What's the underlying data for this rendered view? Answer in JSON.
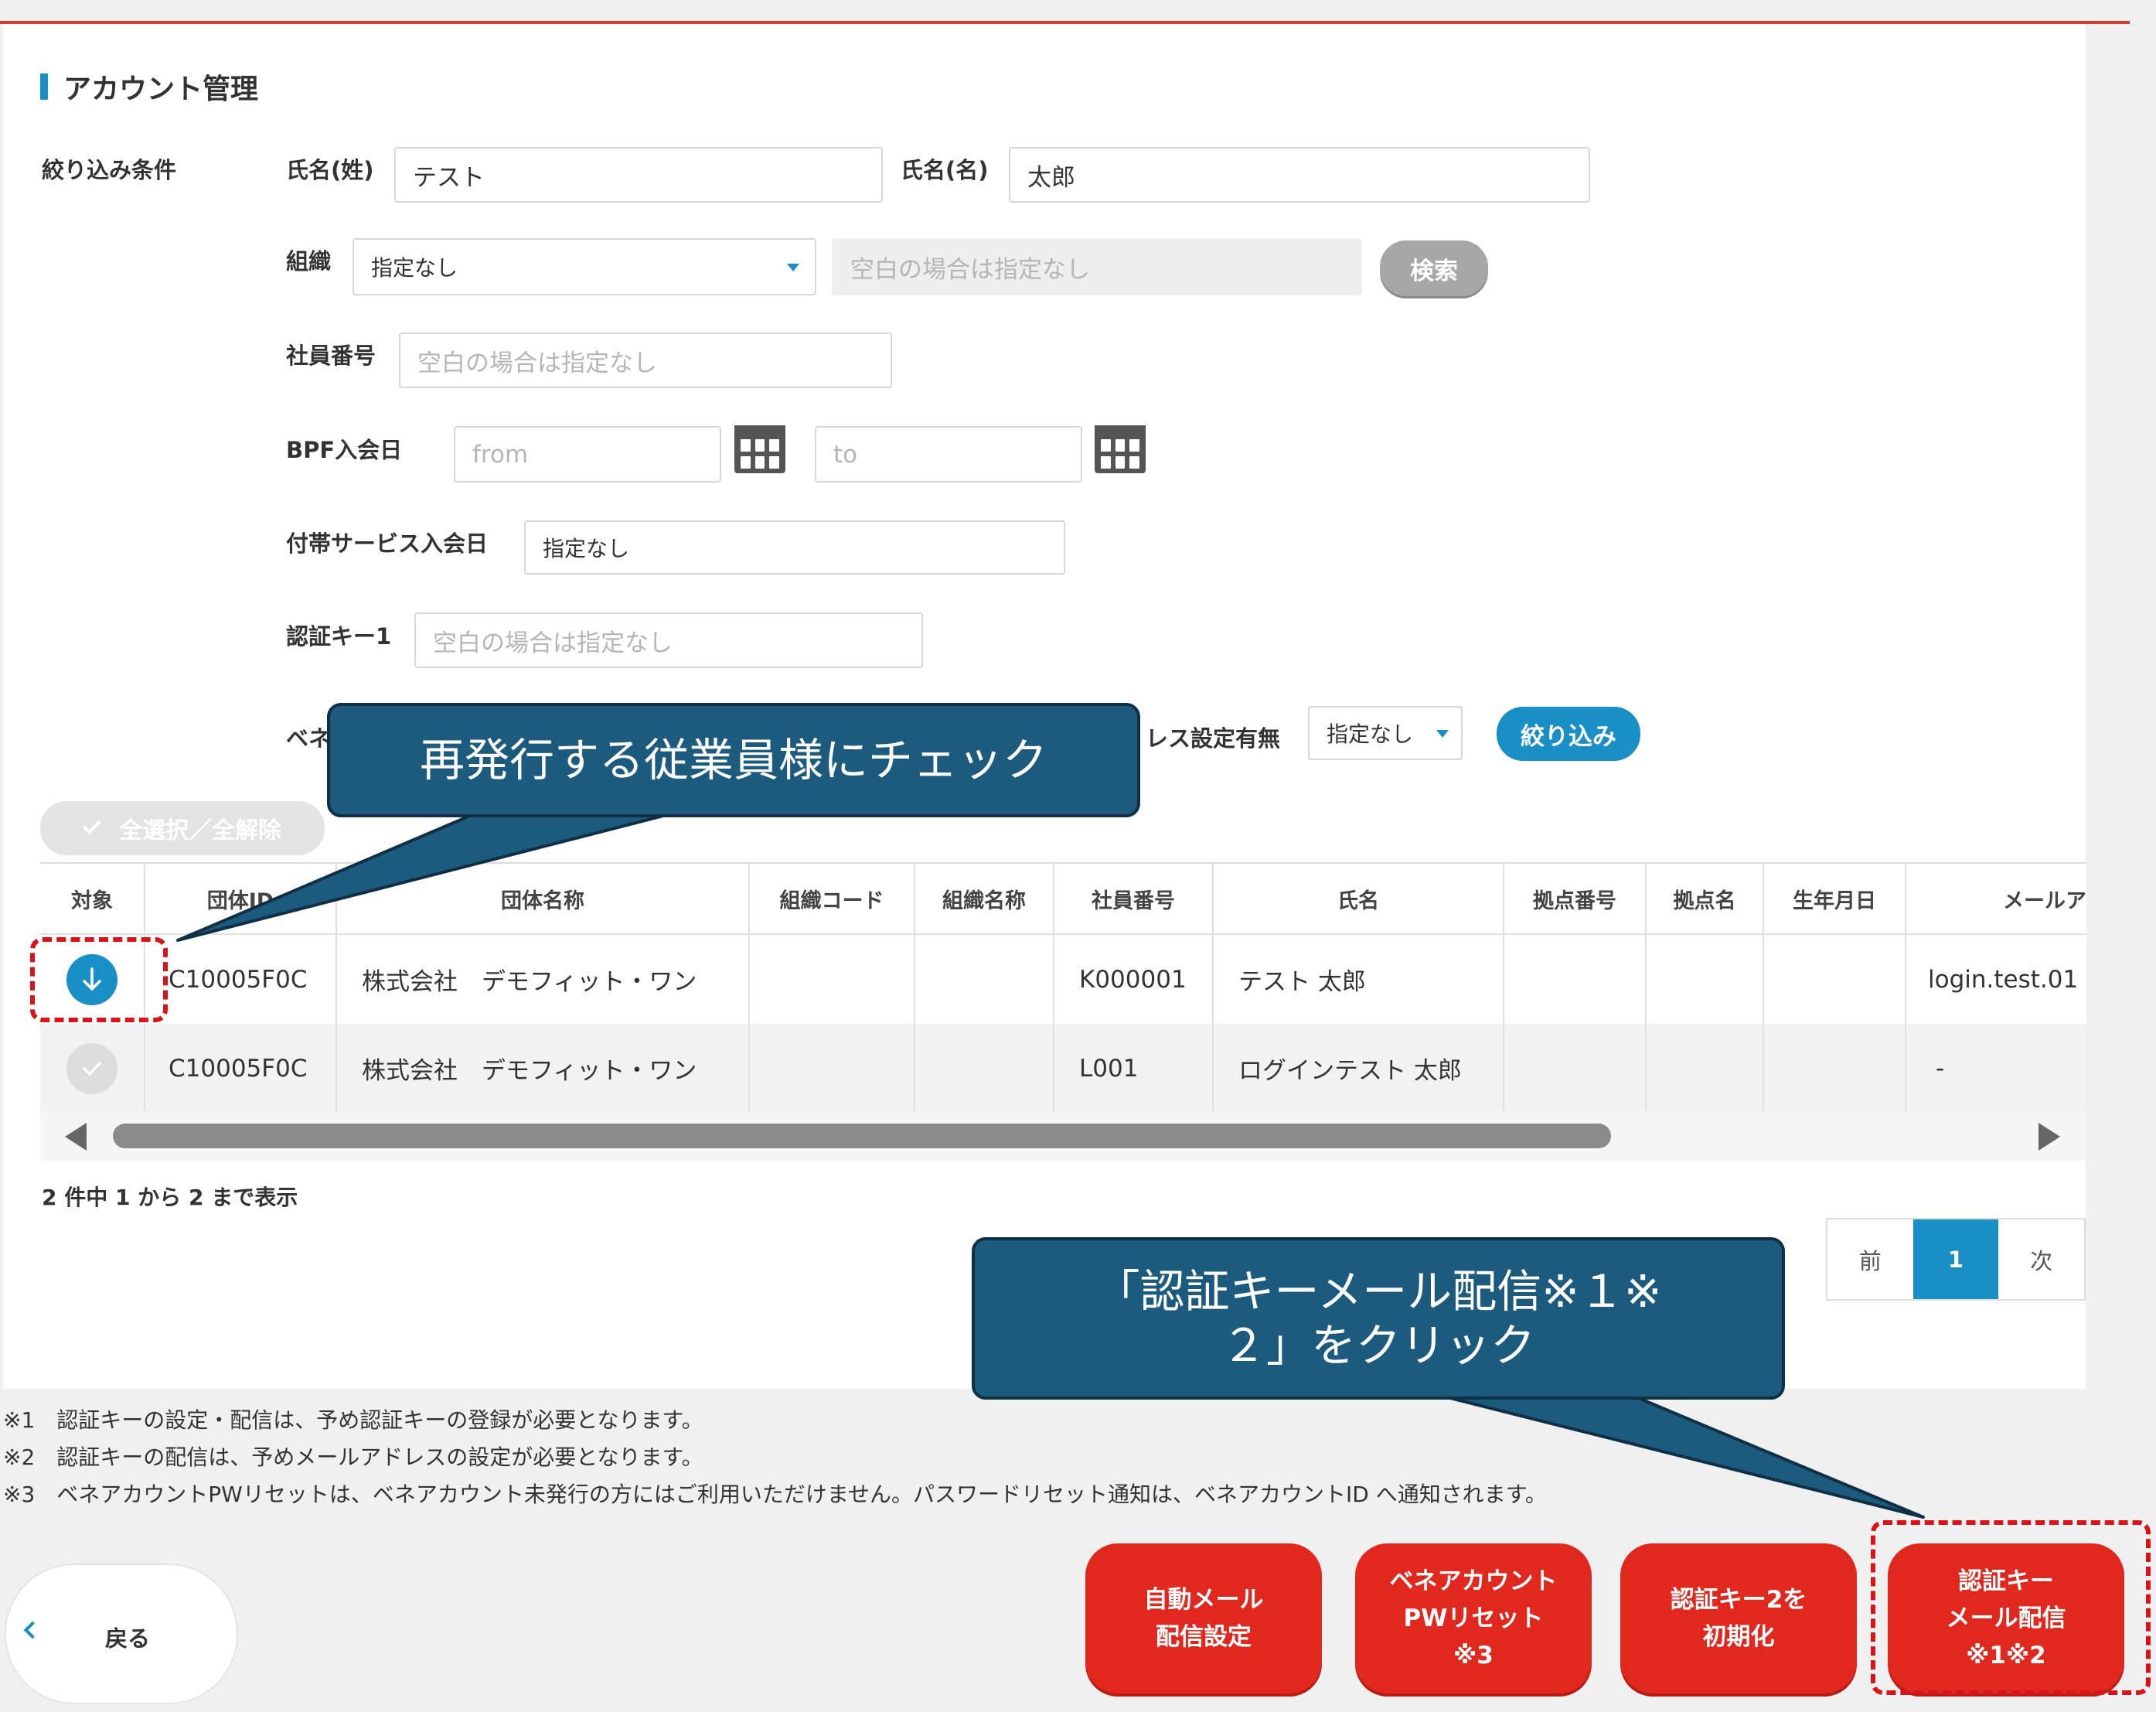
{
  "page": {
    "title": "アカウント管理"
  },
  "filters": {
    "section_label": "絞り込み条件",
    "last_name": {
      "label": "氏名(姓)",
      "value": "テスト"
    },
    "first_name": {
      "label": "氏名(名)",
      "value": "太郎"
    },
    "org": {
      "label": "組織",
      "select": "指定なし",
      "placeholder": "空白の場合は指定なし",
      "search": "検索"
    },
    "employee_no": {
      "label": "社員番号",
      "placeholder": "空白の場合は指定なし"
    },
    "bpf_join": {
      "label": "BPF入会日",
      "from": "from",
      "to": "to"
    },
    "service_join": {
      "label": "付帯サービス入会日",
      "value": "指定なし"
    },
    "auth_key1": {
      "label": "認証キー1",
      "placeholder": "空白の場合は指定なし"
    },
    "bene_prefix": "ベネ",
    "mail_setting": {
      "label": "レス設定有無",
      "value": "指定なし"
    },
    "apply": "絞り込み"
  },
  "select_all": "全選択／全解除",
  "table": {
    "headers": [
      "対象",
      "団体ID",
      "団体名称",
      "組織コード",
      "組織名称",
      "社員番号",
      "氏名",
      "拠点番号",
      "拠点名",
      "生年月日",
      "メールア"
    ],
    "rows": [
      [
        "",
        "C10005F0C",
        "株式会社　デモフィット・ワン",
        "",
        "",
        "K000001",
        "テスト 太郎",
        "",
        "",
        "",
        "login.test.01"
      ],
      [
        "",
        "C10005F0C",
        "株式会社　デモフィット・ワン",
        "",
        "",
        "L001",
        "ログインテスト 太郎",
        "",
        "",
        "",
        "-"
      ]
    ]
  },
  "summary": "2 件中 1 から 2 まで表示",
  "pager": {
    "prev": "前",
    "current": "1",
    "next": "次"
  },
  "notes": [
    "※1　認証キーの設定・配信は、予め認証キーの登録が必要となります。",
    "※2　認証キーの配信は、予めメールアドレスの設定が必要となります。",
    "※3　ベネアカウントPWリセットは、ベネアカウント未発行の方にはご利用いただけません。パスワードリセット通知は、ベネアカウントID へ通知されます。"
  ],
  "buttons": {
    "back": "戻る",
    "auto_mail": [
      "自動メール",
      "配信設定"
    ],
    "bene_reset": [
      "ベネアカウント",
      "PWリセット",
      "※3"
    ],
    "init_key2": [
      "認証キー2を",
      "初期化"
    ],
    "send_key": [
      "認証キー",
      "メール配信",
      "※1※2"
    ]
  },
  "callouts": {
    "check": "再発行する従業員様にチェック",
    "click_line1": "「認証キーメール配信※１※",
    "click_line2": "２」をクリック"
  },
  "colors": {
    "accent": "#1a8fc6",
    "brand_red": "#e0281e",
    "callout": "#1c5a7e",
    "dash": "#d8141a"
  }
}
